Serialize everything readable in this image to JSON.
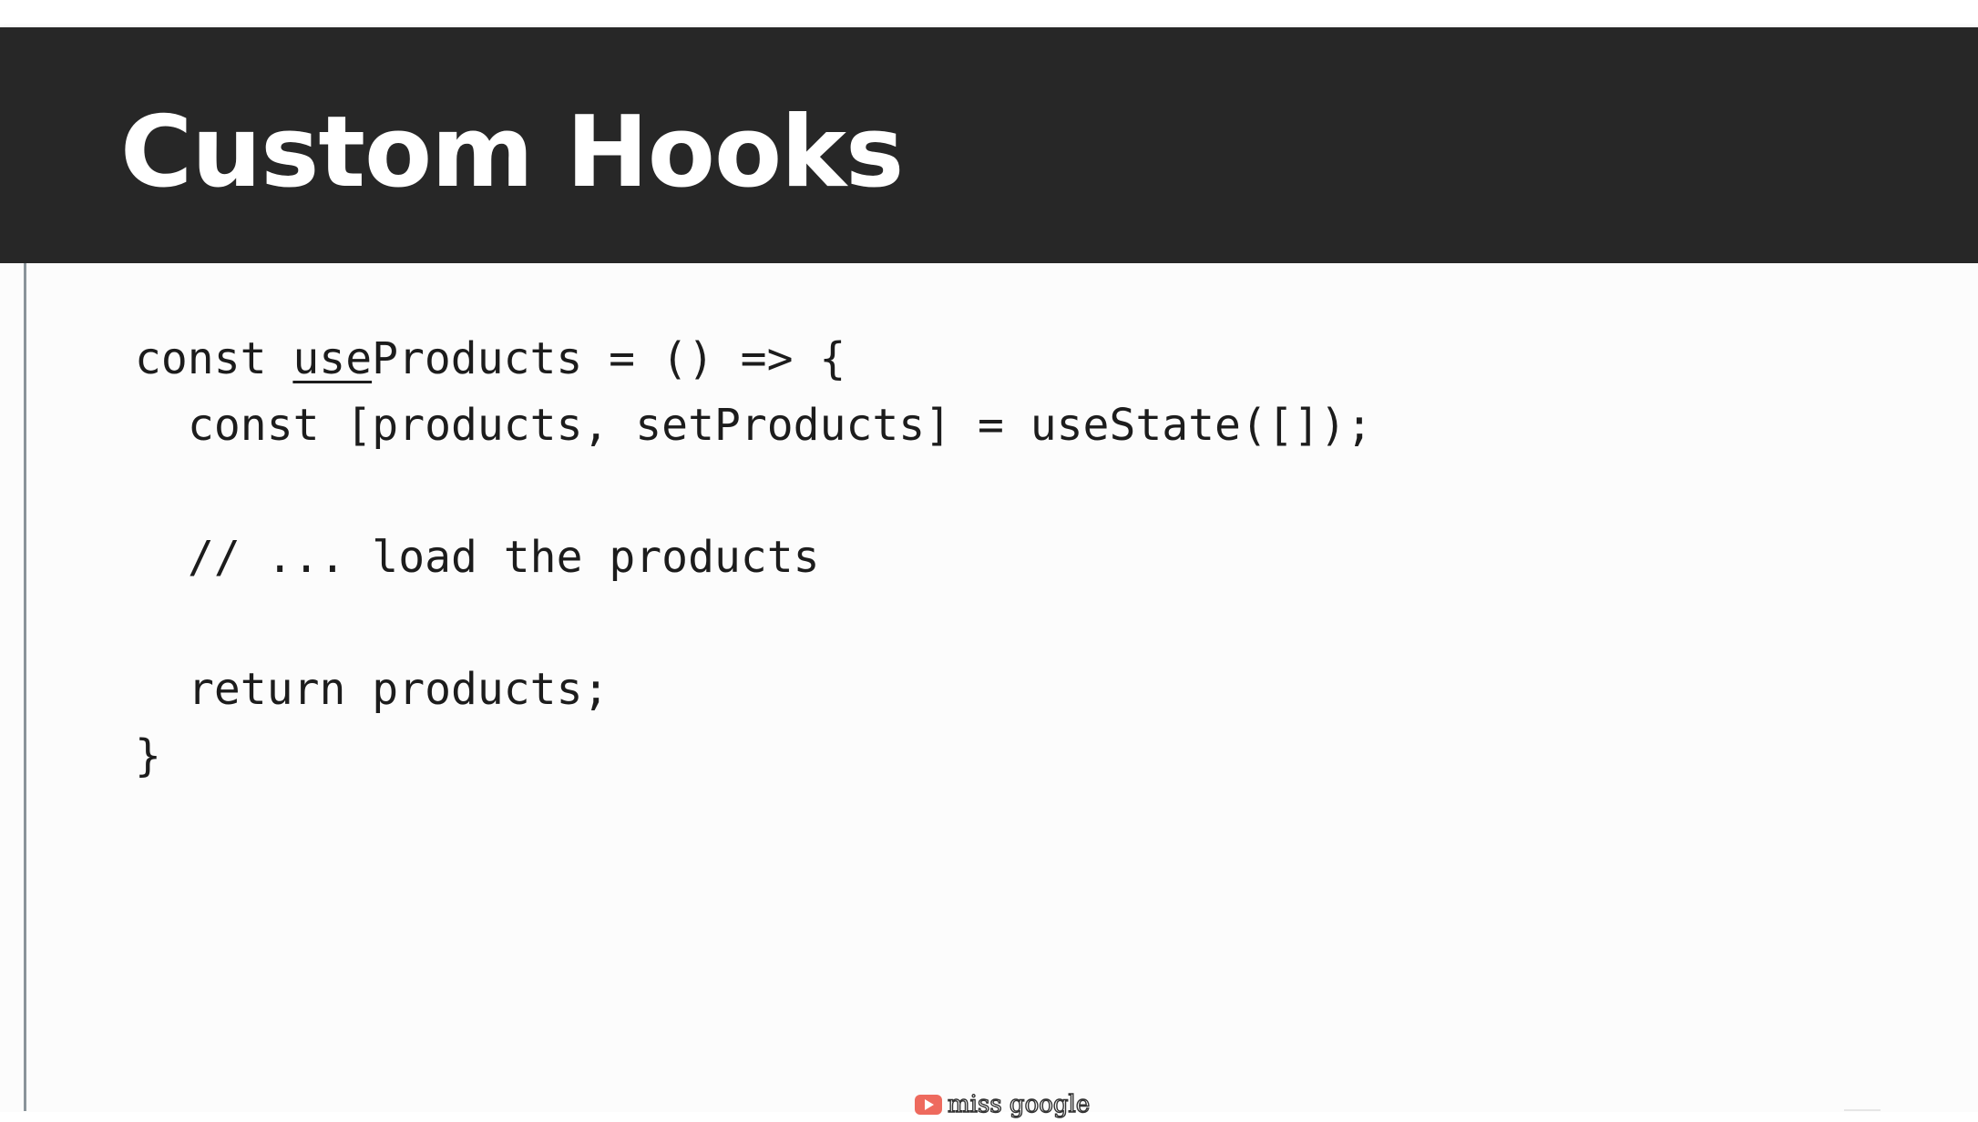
{
  "slide": {
    "title": "Custom Hooks"
  },
  "code": {
    "line1_prefix": "const ",
    "line1_underlined": "use",
    "line1_suffix": "Products = () => {",
    "line2": "const [products, setProducts] = useState([]);",
    "line3": "",
    "line4": "// ... load the products",
    "line5": "",
    "line6": "return products;",
    "line7": "}"
  },
  "watermark": {
    "icon": "youtube-icon",
    "icon_color": "#ee6a5e",
    "text": "miss google"
  },
  "colors": {
    "title_bar": "#272727",
    "title_text": "#ffffff",
    "code_text": "#1c1c1c",
    "background": "#fcfcfc"
  }
}
